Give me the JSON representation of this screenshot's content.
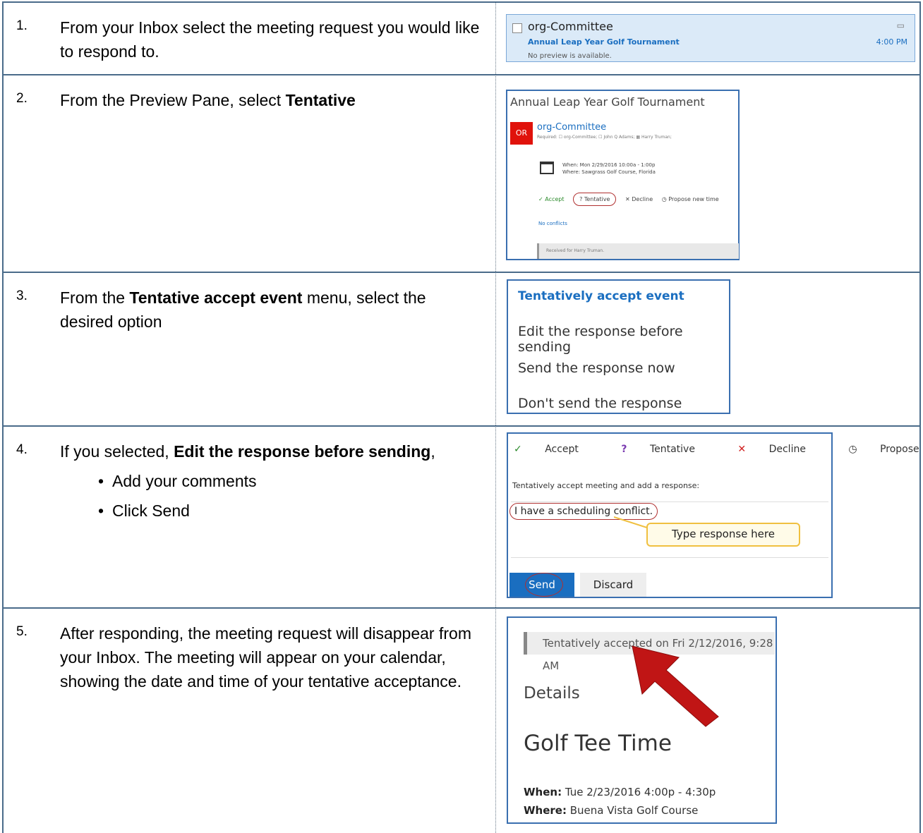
{
  "steps": [
    {
      "num": "1.",
      "text": "From your Inbox select the meeting request you would like to respond to."
    },
    {
      "num": "2.",
      "text_pre": "From the Preview Pane, select ",
      "text_bold": "Tentative"
    },
    {
      "num": "3.",
      "text_pre": "From the ",
      "text_bold": "Tentative accept event",
      "text_post": " menu, select the desired option"
    },
    {
      "num": "4.",
      "text_pre": "If you selected, ",
      "text_bold": "Edit the response before sending",
      "text_post": ",",
      "bullets": [
        "Add your comments",
        "Click Send"
      ]
    },
    {
      "num": "5.",
      "text": "After responding, the meeting request will disappear from your Inbox. The meeting will appear on your calendar, showing the date and time of your tentative acceptance."
    }
  ],
  "inbox": {
    "from": "org-Committee",
    "subject": "Annual Leap Year Golf Tournament",
    "preview": "No preview is available.",
    "time": "4:00 PM"
  },
  "preview_pane": {
    "title": "Annual Leap Year Golf Tournament",
    "avatar": "OR",
    "organizer": "org-Committee",
    "required": "Required: ☐ org-Committee; ☐ John Q Adams; ▦ Harry Truman;",
    "when": "When:  Mon 2/29/2016 10:00a - 1:00p",
    "where": "Where:  Sawgrass Golf Course, Florida",
    "accept": "✓ Accept",
    "tentative": "? Tentative",
    "decline": "✕ Decline",
    "propose": "◷ Propose new time",
    "no_conflicts": "No conflicts",
    "received": "Received for Harry Truman."
  },
  "tent_menu": {
    "header": "Tentatively accept event",
    "items": [
      "Edit the response before sending",
      "Send the response now",
      "Don't send the response"
    ]
  },
  "response": {
    "accept": "Accept",
    "tentative": "Tentative",
    "decline": "Decline",
    "propose": "Propose new time",
    "label": "Tentatively accept meeting and add a response:",
    "text": "I have a scheduling conflict.",
    "callout": "Type response here",
    "send": "Send",
    "discard": "Discard"
  },
  "details": {
    "accepted": "Tentatively accepted on Fri 2/12/2016, 9:28 AM",
    "heading": "Details",
    "title": "Golf Tee Time",
    "when_label": "When:",
    "when": "Tue 2/23/2016 4:00p - 4:30p",
    "where_label": "Where:",
    "where": "Buena Vista Golf Course"
  }
}
